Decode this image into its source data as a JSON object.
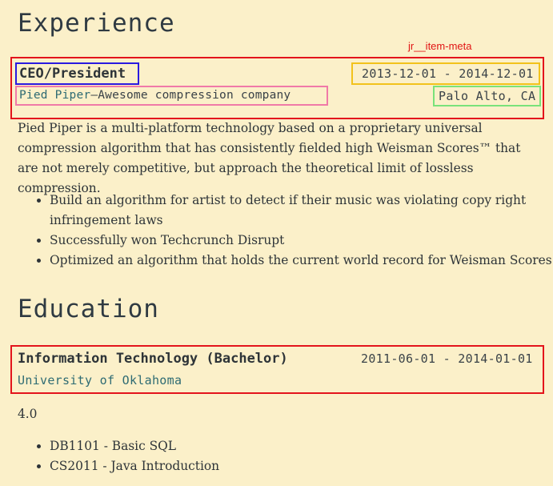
{
  "annotation_label": "jr__item-meta",
  "experience": {
    "heading": "Experience",
    "position": "CEO/President",
    "dates": "2013-12-01 - 2014-12-01",
    "company": "Pied Piper",
    "company_separator": " — ",
    "company_tagline": "Awesome compression company",
    "location": "Palo Alto, CA",
    "summary": "Pied Piper is a multi-platform technology based on a proprietary universal compression algorithm that has consistently fielded high Weisman Scores™ that are not merely competitive, but approach the theoretical limit of lossless compression.",
    "highlights": [
      "Build an algorithm for artist to detect if their music was violating copy right infringement laws",
      "Successfully won Techcrunch Disrupt",
      "Optimized an algorithm that holds the current world record for Weisman Scores"
    ]
  },
  "education": {
    "heading": "Education",
    "degree": "Information Technology (Bachelor)",
    "dates": "2011-06-01 - 2014-01-01",
    "institution": "University of Oklahoma",
    "gpa": "4.0",
    "courses": [
      "DB1101 - Basic SQL",
      "CS2011 - Java Introduction"
    ]
  },
  "colors": {
    "background": "#fbf0c9",
    "text": "#2e3438",
    "link_teal": "#2e6b73",
    "frame_red": "#e3141c",
    "box_blue": "#2a1ae0",
    "box_yellow": "#f2c21b",
    "box_pink": "#f07aa8",
    "box_green": "#7ae27a"
  }
}
